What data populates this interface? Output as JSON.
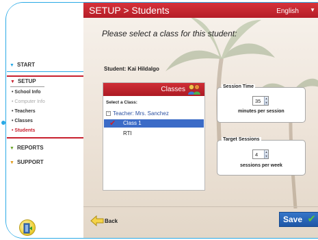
{
  "header": {
    "title": "SETUP > Students",
    "language": "English"
  },
  "nav": {
    "start": "START",
    "setup": "SETUP",
    "setup_items": [
      {
        "label": "School Info",
        "state": "normal"
      },
      {
        "label": "Computer Info",
        "state": "disabled"
      },
      {
        "label": "Teachers",
        "state": "normal"
      },
      {
        "label": "Classes",
        "state": "normal"
      },
      {
        "label": "Students",
        "state": "active"
      }
    ],
    "reports": "REPORTS",
    "support": "SUPPORT"
  },
  "main": {
    "prompt": "Please select a class for this student:",
    "student_line": "Student: Kai Hildalgo"
  },
  "classes_panel": {
    "header": "Classes",
    "select_label": "Select a Class:",
    "teacher": "Teacher: Mrs. Sanchez",
    "items": [
      {
        "label": "Class 1",
        "selected": true
      },
      {
        "label": "RTI",
        "selected": false
      }
    ]
  },
  "session_time": {
    "title": "Session Time",
    "value": "35",
    "caption": "minutes per session"
  },
  "target_sessions": {
    "title": "Target Sessions",
    "value": "4",
    "caption": "sessions per week"
  },
  "footer": {
    "back_label": "Back",
    "save_label": "Save"
  },
  "colors": {
    "accent_red": "#c8202e",
    "frame_blue": "#29a9e6",
    "selection_blue": "#3b6bc7"
  }
}
